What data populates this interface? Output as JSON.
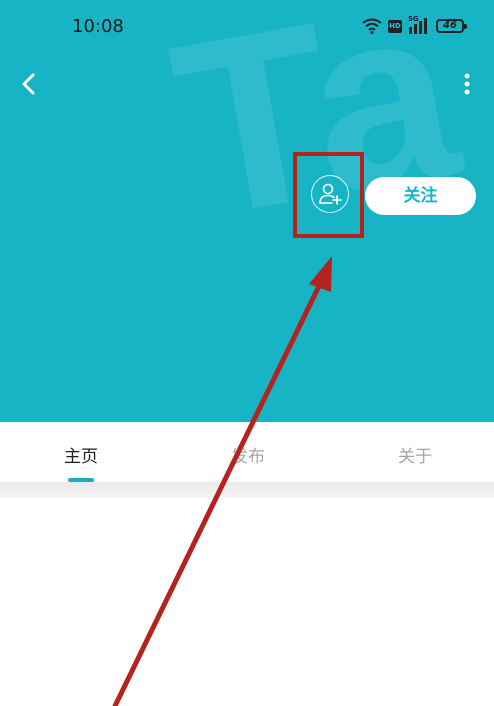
{
  "status_bar": {
    "time": "10:08",
    "network_label": "5G",
    "hd_label": "HD",
    "battery": "46"
  },
  "header": {
    "follow_label": "关注",
    "watermark_text": "Ta"
  },
  "tabs": [
    {
      "label": "主页",
      "active": true
    },
    {
      "label": "发布",
      "active": false
    },
    {
      "label": "关于",
      "active": false
    }
  ],
  "colors": {
    "hero_background": "#17b4c6",
    "accent": "#1aadbf",
    "annotation": "#b5231e"
  },
  "icons": {
    "back": "chevron-left-icon",
    "more": "more-vertical-icon",
    "add_friend": "user-add-icon",
    "wifi": "wifi-icon",
    "signal": "signal-icon",
    "battery": "battery-icon"
  }
}
